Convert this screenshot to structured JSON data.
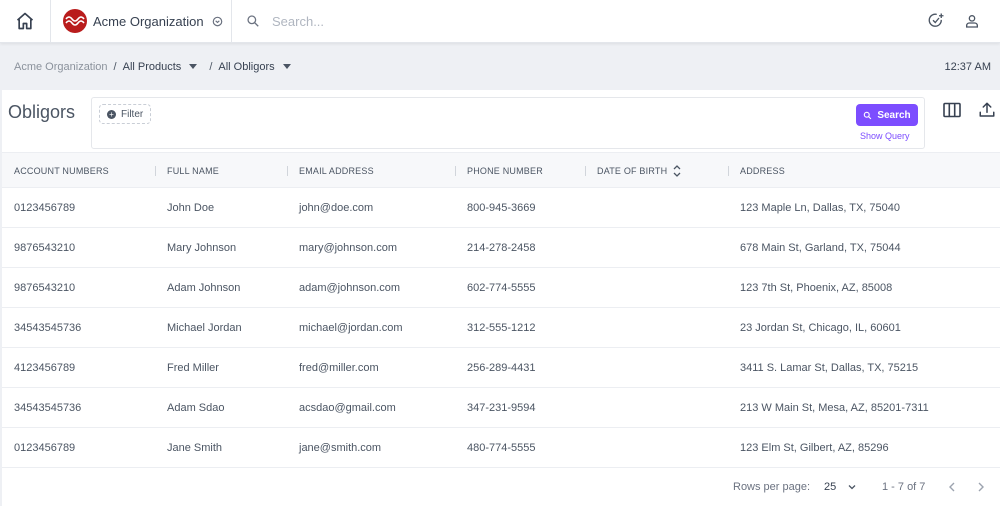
{
  "topbar": {
    "org_name": "Acme Organization",
    "search_placeholder": "Search..."
  },
  "breadcrumb": {
    "root": "Acme Organization",
    "sep": "/",
    "product": "All Products",
    "section": "All Obligors"
  },
  "clock": "12:37 AM",
  "panel": {
    "title": "Obligors",
    "filter_label": "Filter",
    "search_label": "Search",
    "show_query": "Show Query"
  },
  "table": {
    "columns": [
      "ACCOUNT NUMBERS",
      "FULL NAME",
      "EMAIL ADDRESS",
      "PHONE NUMBER",
      "DATE OF BIRTH",
      "ADDRESS"
    ],
    "rows": [
      [
        "0123456789",
        "John Doe",
        "john@doe.com",
        "800-945-3669",
        "",
        "123 Maple Ln, Dallas, TX, 75040"
      ],
      [
        "9876543210",
        "Mary Johnson",
        "mary@johnson.com",
        "214-278-2458",
        "",
        "678 Main St, Garland, TX, 75044"
      ],
      [
        "9876543210",
        "Adam Johnson",
        "adam@johnson.com",
        "602-774-5555",
        "",
        "123 7th St, Phoenix, AZ, 85008"
      ],
      [
        "34543545736",
        "Michael Jordan",
        "michael@jordan.com",
        "312-555-1212",
        "",
        "23 Jordan St, Chicago, IL, 60601"
      ],
      [
        "4123456789",
        "Fred Miller",
        "fred@miller.com",
        "256-289-4431",
        "",
        "3411 S. Lamar St, Dallas, TX, 75215"
      ],
      [
        "34543545736",
        "Adam Sdao",
        "acsdao@gmail.com",
        "347-231-9594",
        "",
        "213 W Main St, Mesa, AZ, 85201-7311"
      ],
      [
        "0123456789",
        "Jane Smith",
        "jane@smith.com",
        "480-774-5555",
        "",
        "123 Elm St, Gilbert, AZ, 85296"
      ]
    ]
  },
  "pager": {
    "rows_per_page_label": "Rows per page:",
    "rows_per_page": "25",
    "range": "1 - 7 of 7"
  },
  "colors": {
    "accent": "#7c4dff",
    "brand_logo": "#b91c1c"
  }
}
